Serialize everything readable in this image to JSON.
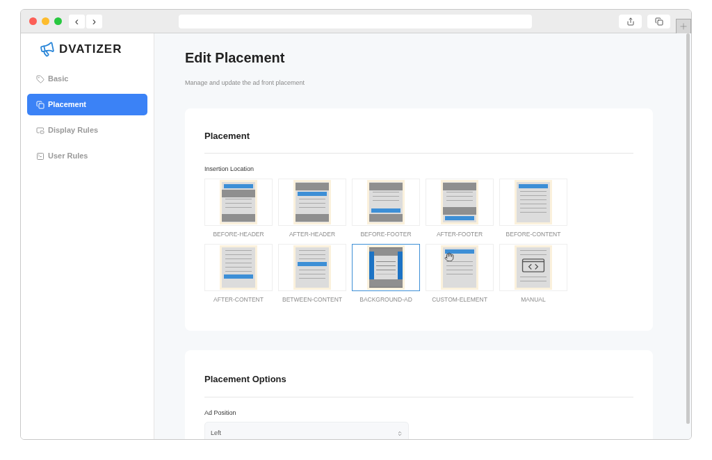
{
  "browser": {
    "nav": [
      "‹",
      "›"
    ]
  },
  "logo": {
    "text": "DVATIZER"
  },
  "sidebar": {
    "items": [
      {
        "label": "Basic",
        "selected": false
      },
      {
        "label": "Placement",
        "selected": true
      },
      {
        "label": "Display Rules",
        "selected": false
      },
      {
        "label": "User Rules",
        "selected": false
      }
    ]
  },
  "page": {
    "title": "Edit Placement",
    "subtitle": "Manage and update the ad front placement"
  },
  "placement": {
    "title": "Placement",
    "field_label": "Insertion Location",
    "options": [
      {
        "label": "BEFORE-HEADER",
        "selected": false,
        "preview": [
          {
            "kind": "ad"
          },
          {
            "kind": "header"
          },
          {
            "kind": "line"
          },
          {
            "kind": "line"
          },
          {
            "kind": "line"
          },
          {
            "kind": "spacer"
          },
          {
            "kind": "footer"
          }
        ]
      },
      {
        "label": "AFTER-HEADER",
        "selected": false,
        "preview": [
          {
            "kind": "header"
          },
          {
            "kind": "ad"
          },
          {
            "kind": "line"
          },
          {
            "kind": "line"
          },
          {
            "kind": "line"
          },
          {
            "kind": "spacer"
          },
          {
            "kind": "footer"
          }
        ]
      },
      {
        "label": "BEFORE-FOOTER",
        "selected": false,
        "preview": [
          {
            "kind": "header"
          },
          {
            "kind": "line"
          },
          {
            "kind": "line"
          },
          {
            "kind": "line"
          },
          {
            "kind": "spacer"
          },
          {
            "kind": "ad"
          },
          {
            "kind": "footer"
          }
        ]
      },
      {
        "label": "AFTER-FOOTER",
        "selected": false,
        "preview": [
          {
            "kind": "header"
          },
          {
            "kind": "line"
          },
          {
            "kind": "line"
          },
          {
            "kind": "line"
          },
          {
            "kind": "spacer"
          },
          {
            "kind": "footer"
          },
          {
            "kind": "ad"
          }
        ]
      },
      {
        "label": "BEFORE-CONTENT",
        "selected": false,
        "preview": [
          {
            "kind": "ad"
          },
          {
            "kind": "line"
          },
          {
            "kind": "line"
          },
          {
            "kind": "line"
          },
          {
            "kind": "line"
          },
          {
            "kind": "line"
          },
          {
            "kind": "line"
          }
        ]
      },
      {
        "label": "AFTER-CONTENT",
        "selected": false,
        "preview": [
          {
            "kind": "line"
          },
          {
            "kind": "line"
          },
          {
            "kind": "line"
          },
          {
            "kind": "line"
          },
          {
            "kind": "line"
          },
          {
            "kind": "line"
          },
          {
            "kind": "ad"
          }
        ]
      },
      {
        "label": "BETWEEN-CONTENT",
        "selected": false,
        "preview": [
          {
            "kind": "line"
          },
          {
            "kind": "line"
          },
          {
            "kind": "line"
          },
          {
            "kind": "ad"
          },
          {
            "kind": "line"
          },
          {
            "kind": "line"
          },
          {
            "kind": "line"
          }
        ]
      },
      {
        "label": "BACKGROUND-AD",
        "selected": true,
        "preview": [
          {
            "kind": "header"
          },
          {
            "kind": "side-ads"
          },
          {
            "kind": "footer"
          }
        ]
      },
      {
        "label": "CUSTOM-ELEMENT",
        "selected": false,
        "preview": [
          {
            "kind": "ad"
          },
          {
            "kind": "hand"
          },
          {
            "kind": "line"
          },
          {
            "kind": "line"
          },
          {
            "kind": "line"
          },
          {
            "kind": "line"
          }
        ]
      },
      {
        "label": "MANUAL",
        "selected": false,
        "preview": [
          {
            "kind": "line"
          },
          {
            "kind": "line"
          },
          {
            "kind": "code"
          },
          {
            "kind": "line"
          },
          {
            "kind": "line"
          }
        ]
      }
    ]
  },
  "options_card": {
    "title": "Placement Options",
    "field_label": "Ad Position",
    "value": "Left"
  }
}
